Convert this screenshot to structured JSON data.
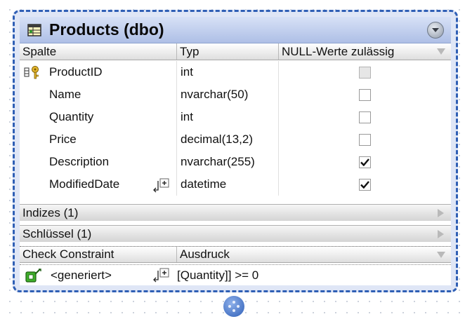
{
  "table": {
    "title": "Products (dbo)",
    "columns_header": {
      "col_name": "Spalte",
      "col_type": "Typ",
      "col_null": "NULL-Werte zulässig"
    },
    "rows": [
      {
        "name": "ProductID",
        "type": "int",
        "nullable": false,
        "primary_key": true
      },
      {
        "name": "Name",
        "type": "nvarchar(50)",
        "nullable": false
      },
      {
        "name": "Quantity",
        "type": "int",
        "nullable": false
      },
      {
        "name": "Price",
        "type": "decimal(13,2)",
        "nullable": false
      },
      {
        "name": "Description",
        "type": "nvarchar(255)",
        "nullable": true
      },
      {
        "name": "ModifiedDate",
        "type": "datetime",
        "nullable": true
      }
    ],
    "sections": {
      "indexes": "Indizes (1)",
      "keys": "Schlüssel (1)"
    },
    "check_constraint": {
      "header_name": "Check Constraint",
      "header_expr": "Ausdruck",
      "name": "<generiert>",
      "expression": "[Quantity]] >= 0"
    }
  },
  "colors": {
    "border_accent": "#2f5fb5",
    "title_gradient_top": "#d7e1f6",
    "title_gradient_bottom": "#aebfe6",
    "check_icon_green": "#3fae2a"
  },
  "icons": {
    "table": "table-icon",
    "collapse": "collapse-icon",
    "primary_key": "primary-key-icon",
    "expand": "expand-plus-icon",
    "constraint": "add-constraint-icon",
    "handle": "drag-handle-icon"
  }
}
